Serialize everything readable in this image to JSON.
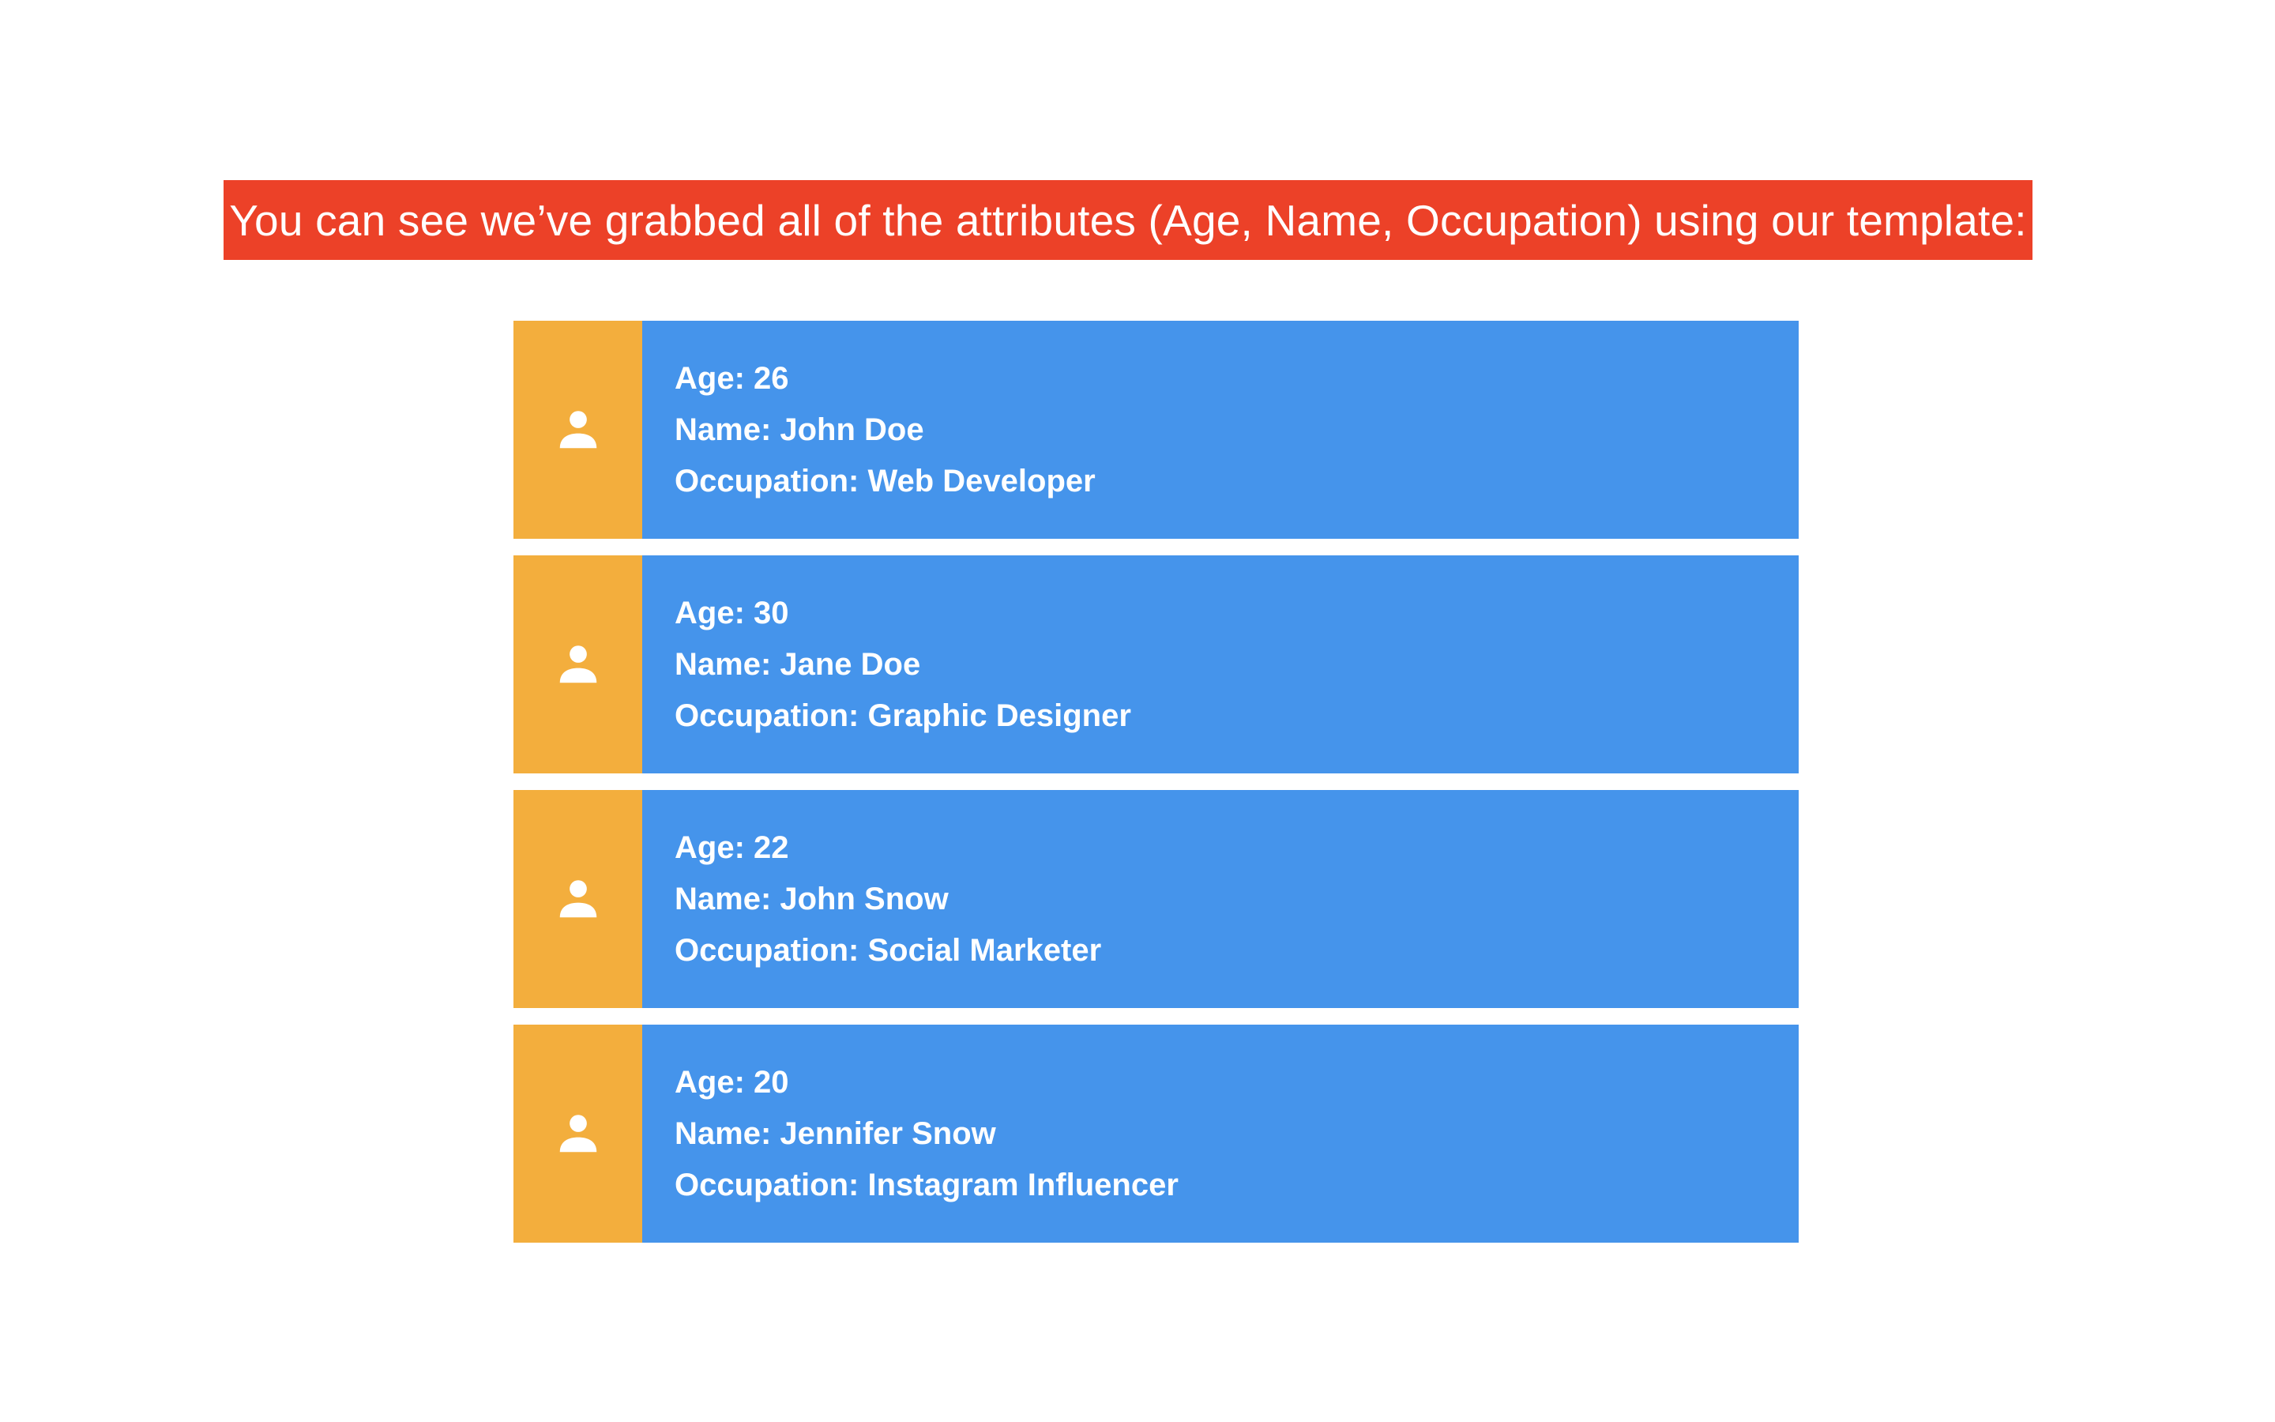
{
  "banner": {
    "text": "You can see we’ve grabbed all of the attributes (Age, Name, Occupation) using our template:",
    "color": "#ec4128"
  },
  "colors": {
    "icon_panel": "#f3ae3d",
    "card_body": "#4594eb",
    "text": "#ffffff"
  },
  "people": [
    {
      "icon": "person-icon",
      "age": "Age: 26",
      "name": "Name: John Doe",
      "occupation": "Occupation: Web Developer"
    },
    {
      "icon": "person-icon",
      "age": "Age: 30",
      "name": "Name: Jane Doe",
      "occupation": "Occupation: Graphic Designer"
    },
    {
      "icon": "person-icon",
      "age": "Age: 22",
      "name": "Name: John Snow",
      "occupation": "Occupation: Social Marketer"
    },
    {
      "icon": "person-icon",
      "age": "Age: 20",
      "name": "Name: Jennifer Snow",
      "occupation": "Occupation: Instagram Influencer"
    }
  ]
}
